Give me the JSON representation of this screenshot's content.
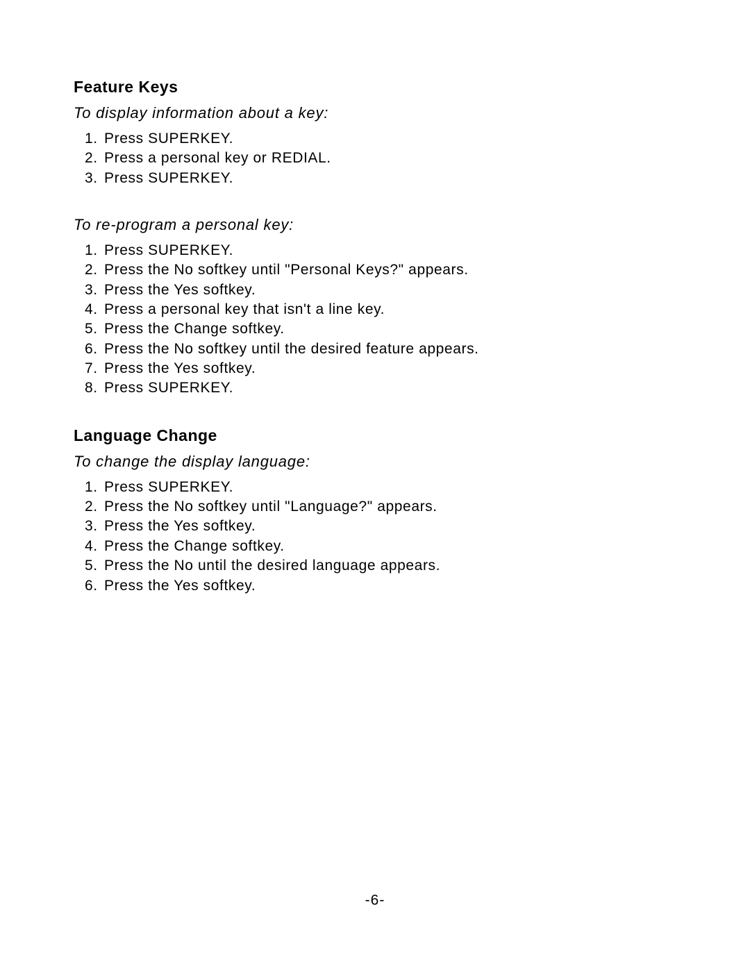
{
  "sections": [
    {
      "heading": "Feature Keys",
      "subsections": [
        {
          "subheading": "To display information about a key:",
          "steps": [
            "Press SUPERKEY.",
            "Press a personal key or REDIAL.",
            "Press SUPERKEY."
          ]
        },
        {
          "subheading": "To re-program a personal key:",
          "steps": [
            "Press SUPERKEY.",
            "Press the No softkey until \"Personal Keys?\" appears.",
            "Press the Yes softkey.",
            "Press a personal key that isn't a line key.",
            "Press the Change softkey.",
            "Press the No softkey until the desired feature appears.",
            "Press the Yes softkey.",
            "Press SUPERKEY."
          ]
        }
      ]
    },
    {
      "heading": "Language Change",
      "subsections": [
        {
          "subheading": "To change the display language:",
          "steps": [
            "Press SUPERKEY.",
            "Press the No softkey until \"Language?\" appears.",
            "Press the Yes softkey.",
            "Press the Change softkey.",
            "Press the No until the desired language appears.",
            "Press the Yes softkey."
          ]
        }
      ]
    }
  ],
  "page_number": "-6-"
}
